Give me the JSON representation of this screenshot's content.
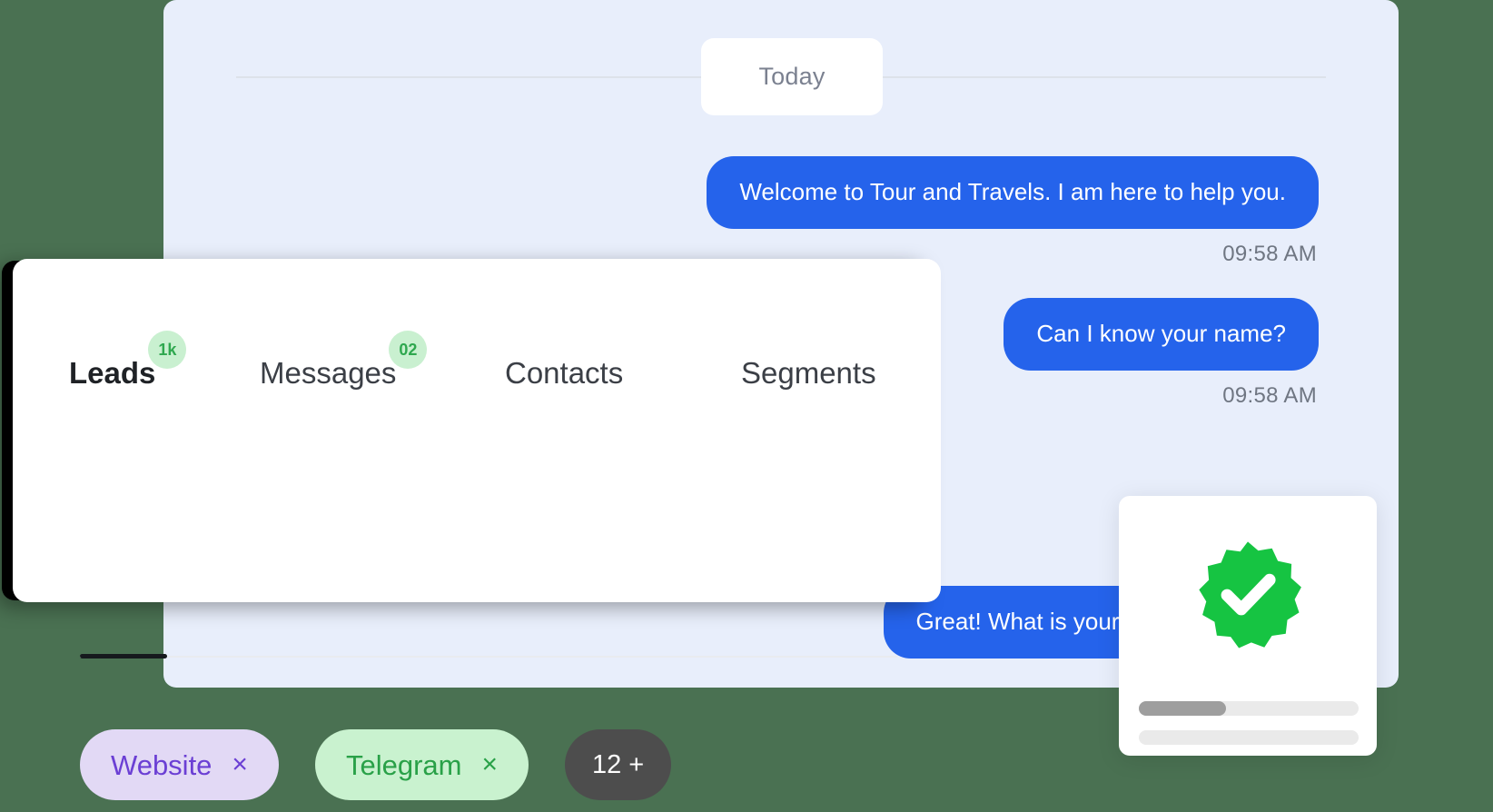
{
  "background_color": "#4a7152",
  "chat": {
    "panel_color": "#e8eefb",
    "day_label": "Today",
    "messages": [
      {
        "text": "Welcome to Tour and Travels. I am here to help you.",
        "time": "09:58 AM",
        "color": "#2563eb"
      },
      {
        "text": "Can I know your name?",
        "time": "09:58 AM",
        "color": "#2563eb"
      },
      {
        "text": "Great! What is your email address?",
        "time": "",
        "color": "#2563eb"
      }
    ]
  },
  "tabs_card": {
    "tabs": [
      {
        "label": "Leads",
        "badge": "1k",
        "active": true
      },
      {
        "label": "Messages",
        "badge": "02",
        "active": false
      },
      {
        "label": "Contacts",
        "badge": "",
        "active": false
      },
      {
        "label": "Segments",
        "badge": "",
        "active": false
      }
    ],
    "badge_color": "#2fa84f",
    "badge_bg": "#c9f0d0",
    "active_underline_color": "#16191d",
    "filters": [
      {
        "label": "Website",
        "remove_icon": "×",
        "text_color": "#6b3fd4",
        "bg_color": "#e2d9f5"
      },
      {
        "label": "Telegram",
        "remove_icon": "×",
        "text_color": "#29a148",
        "bg_color": "#c9f2cf"
      }
    ],
    "more_filters_label": "12 +"
  },
  "success_card": {
    "status_icon": "verified-check",
    "icon_color": "#16c442",
    "progress_percent": 40
  }
}
